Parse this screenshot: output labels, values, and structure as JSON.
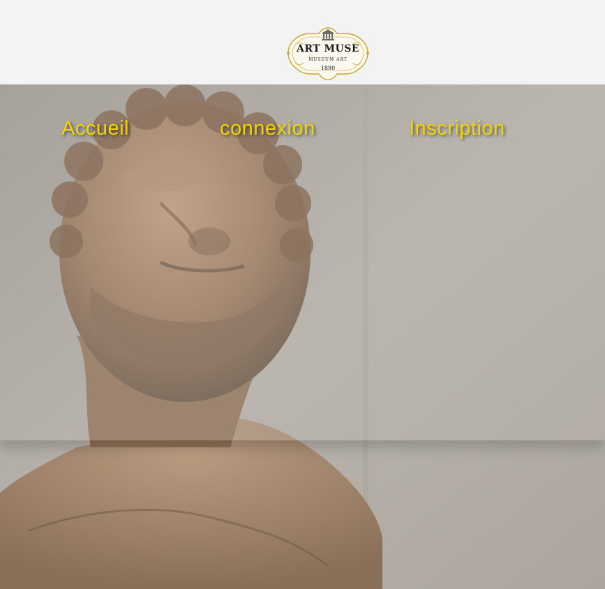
{
  "logo": {
    "title": "ART MUSE",
    "subtitle": "MUSEUM ART",
    "year": "1890",
    "icon": "museum-building-icon",
    "color": "#c9a227"
  },
  "nav": {
    "home_label": "Accueil",
    "login_label": "connexion",
    "signup_label": "Inscription",
    "link_color": "#f2d40c"
  },
  "hero": {
    "image": "marble-bust-statue-photo"
  }
}
